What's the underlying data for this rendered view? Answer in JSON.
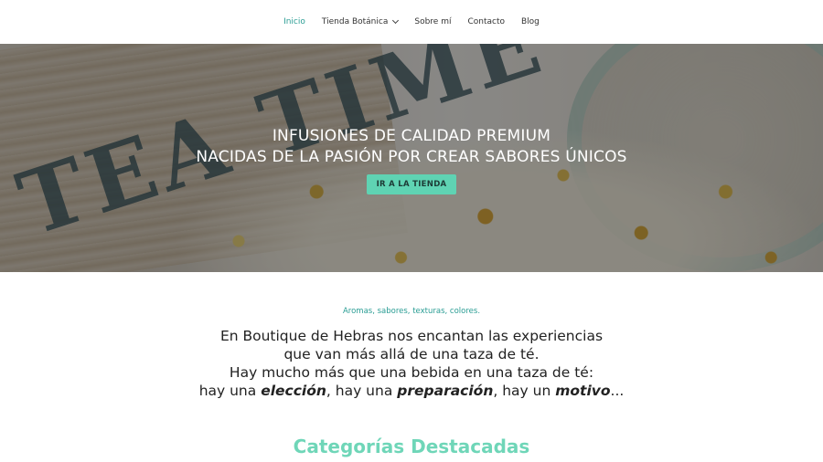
{
  "nav": {
    "items": [
      {
        "label": "Inicio",
        "active": true
      },
      {
        "label": "Tienda Botánica",
        "dropdown": true
      },
      {
        "label": "Sobre mí"
      },
      {
        "label": "Contacto"
      },
      {
        "label": "Blog"
      }
    ]
  },
  "hero": {
    "background_text": "TEA TIME",
    "headline_line1": "INFUSIONES DE CALIDAD PREMIUM",
    "headline_line2": "NACIDAS DE LA PASIÓN POR CREAR SABORES ÚNICOS",
    "cta_label": "IR A LA TIENDA"
  },
  "intro": {
    "tagline": "Aromas, sabores, texturas, colores.",
    "line1": "En Boutique de Hebras nos encantan las experiencias",
    "line2": "que van más allá de una taza de té.",
    "line3": "Hay mucho más que una bebida en una taza de té:",
    "line4_a": "hay una ",
    "line4_b": "elección",
    "line4_c": ", hay una ",
    "line4_d": "preparación",
    "line4_e": ", hay un ",
    "line4_f": "motivo",
    "line4_g": "..."
  },
  "section": {
    "title": "Categorías Destacadas"
  },
  "colors": {
    "accent": "#2a9d94",
    "button": "#5fd3b3",
    "section_title": "#6fd6b8"
  }
}
